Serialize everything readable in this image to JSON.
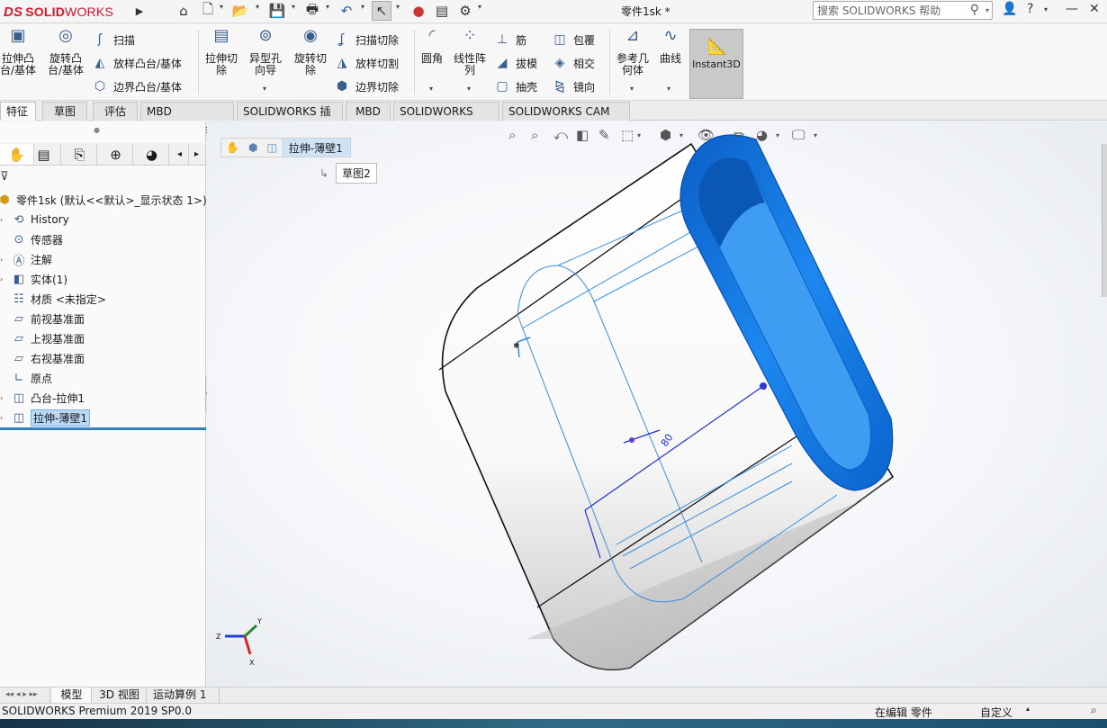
{
  "titlebar": {
    "logo_ds": "DS",
    "logo_solid": "SOLID",
    "logo_works": "WORKS",
    "document_title": "零件1sk *",
    "search_placeholder": "搜索 SOLIDWORKS 帮助"
  },
  "ribbon": {
    "extrude_boss": "拉伸凸台/基体",
    "revolve_boss": "旋转凸台/基体",
    "sweep": "扫描",
    "loft_boss": "放样凸台/基体",
    "boundary_boss": "边界凸台/基体",
    "extrude_cut": "拉伸切除",
    "hole_wizard": "异型孔向导",
    "revolve_cut": "旋转切除",
    "sweep_cut": "扫描切除",
    "loft_cut": "放样切割",
    "boundary_cut": "边界切除",
    "fillet": "圆角",
    "linear_pattern": "线性阵列",
    "rib": "筋",
    "draft": "拔模",
    "shell": "抽壳",
    "wrap": "包覆",
    "intersect": "相交",
    "mirror": "镜向",
    "reference_geometry": "参考几何体",
    "curves": "曲线",
    "instant3d": "Instant3D"
  },
  "tabs": [
    "特征",
    "草图",
    "评估",
    "MBD Dimensions",
    "SOLIDWORKS 插件",
    "MBD",
    "SOLIDWORKS CAM",
    "SOLIDWORKS CAM TBM"
  ],
  "tree": {
    "root": "零件1sk  (默认<<默认>_显示状态 1>)",
    "items": [
      "History",
      "传感器",
      "注解",
      "实体(1)",
      "材质 <未指定>",
      "前视基准面",
      "上视基准面",
      "右视基准面",
      "原点",
      "凸台-拉伸1",
      "拉伸-薄壁1"
    ]
  },
  "viewport": {
    "breadcrumb_active": "拉伸-薄壁1",
    "sketch_label": "草图2",
    "dimension_value": "80",
    "triad": {
      "x": "X",
      "y": "Y",
      "z": "Z"
    }
  },
  "bottom_tabs": [
    "模型",
    "3D 视图",
    "运动算例 1"
  ],
  "status": {
    "product": "SOLIDWORKS Premium 2019 SP0.0",
    "editing": "在编辑 零件",
    "units": "自定义"
  }
}
